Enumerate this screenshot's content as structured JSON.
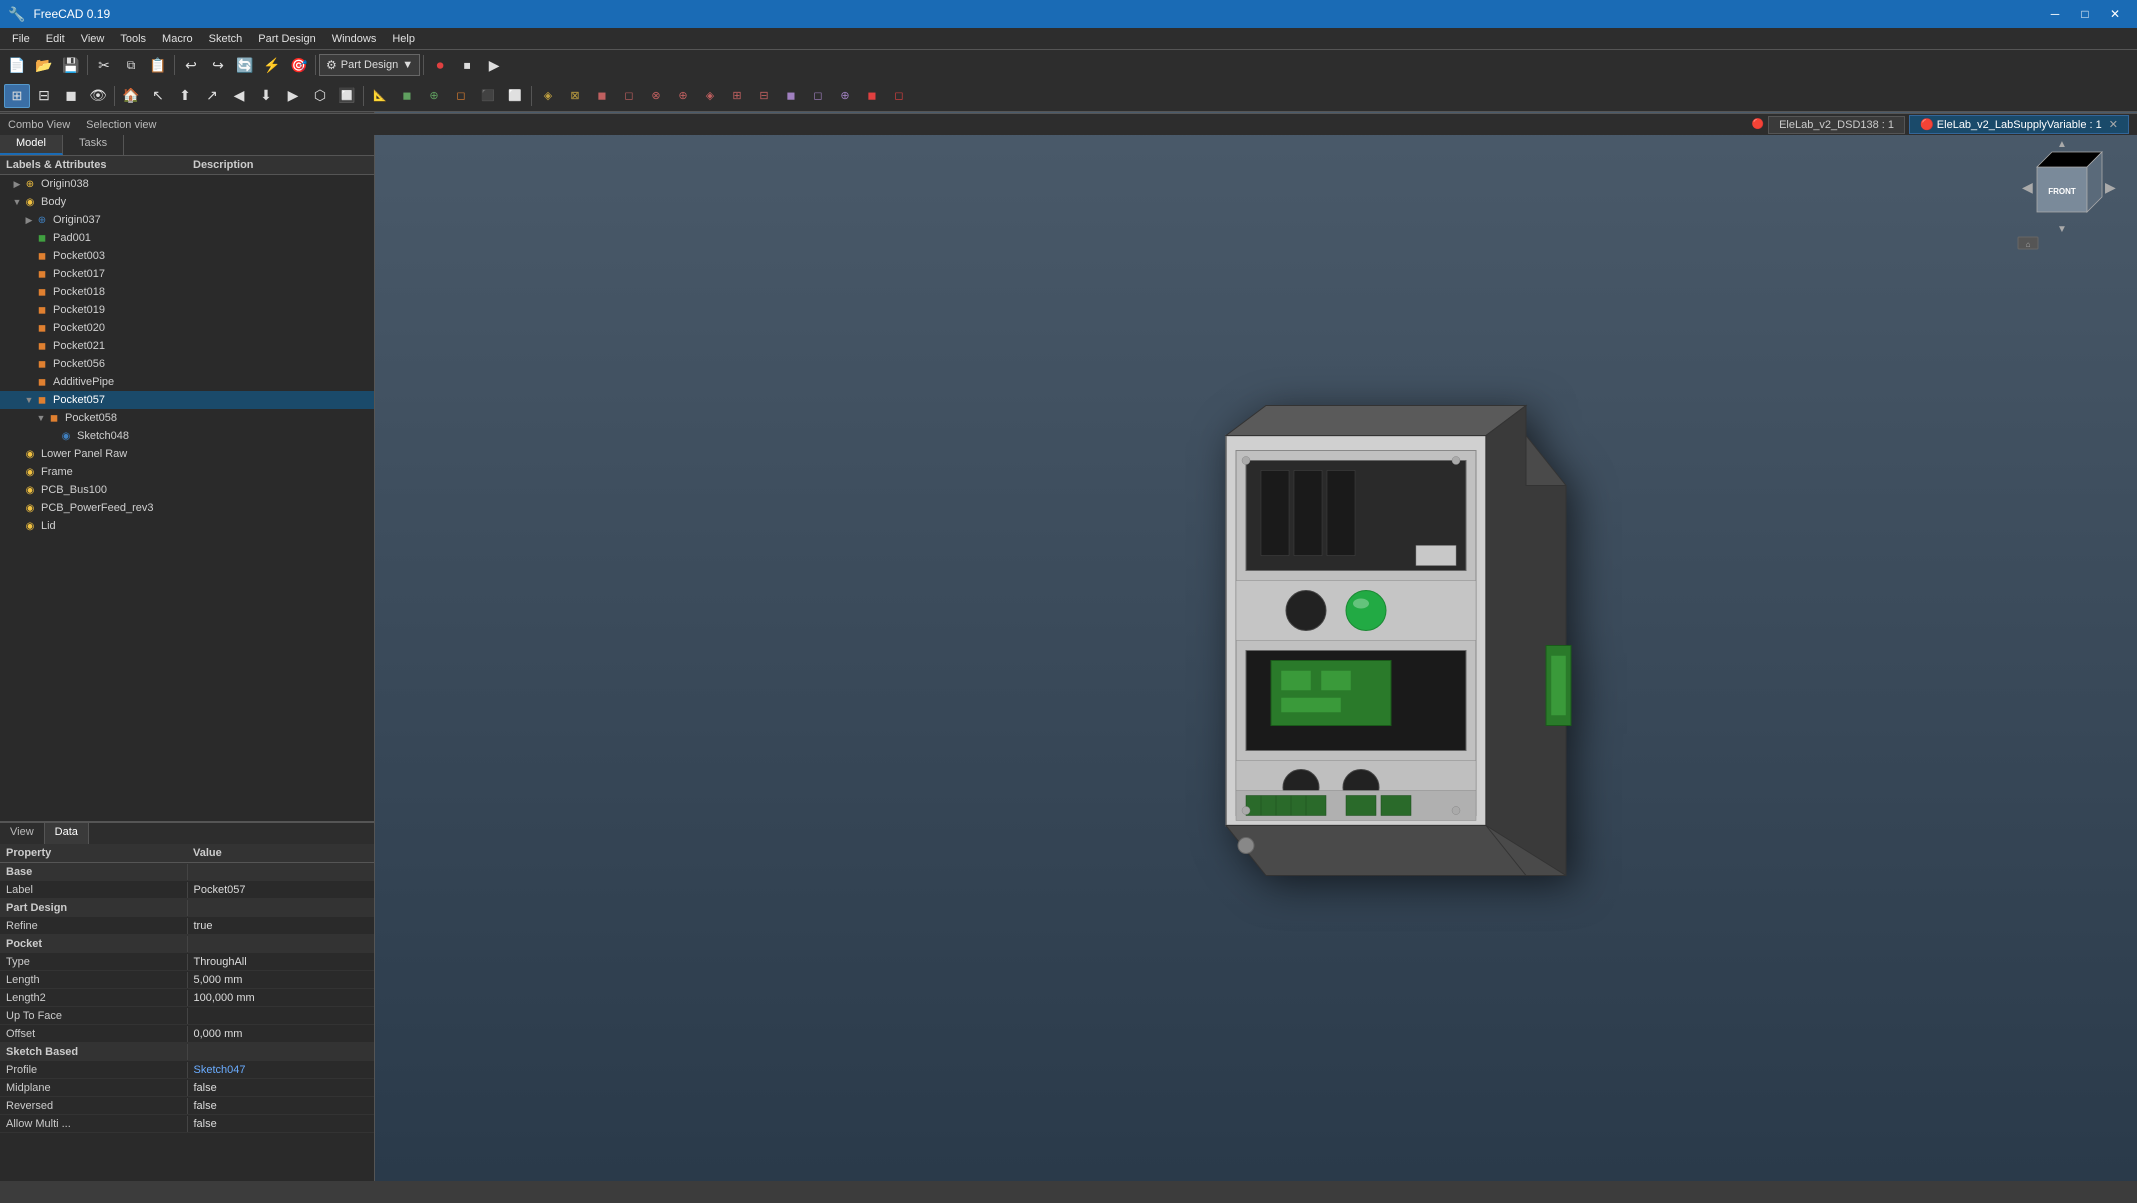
{
  "titlebar": {
    "title": "FreeCAD 0.19",
    "minimize": "─",
    "maximize": "□",
    "close": "✕"
  },
  "menubar": {
    "items": [
      "File",
      "Edit",
      "View",
      "Tools",
      "Macro",
      "Sketch",
      "Part Design",
      "Windows",
      "Help"
    ]
  },
  "toolbar": {
    "workbench_label": "Part Design",
    "toolbar1_icons": [
      "📄",
      "📂",
      "💾",
      "✂",
      "📋",
      "↩",
      "↪",
      "🔄",
      "⚡",
      "🎯"
    ],
    "toolbar2_icons": [
      "🔍",
      "🔲",
      "📐",
      "↖",
      "↗",
      "⬆",
      "◀",
      "▶",
      "⬇",
      "⚙",
      "⬡",
      "🔺",
      "📌",
      "🔗",
      "✈",
      "▷",
      "⏹",
      "📏"
    ],
    "toolbar3_icons": [
      "⬛",
      "⬜",
      "◉",
      "◈",
      "⊕",
      "⬦",
      "◇",
      "●",
      "○",
      "⊗",
      "■",
      "□",
      "▣",
      "▢",
      "⊞",
      "⊟",
      "⊠",
      "⊡",
      "▦",
      "▥",
      "▤",
      "▧",
      "▨",
      "▩",
      "◼",
      "◻"
    ]
  },
  "combo_view": {
    "header": "Combo View"
  },
  "panel_tabs": [
    {
      "label": "Model",
      "active": true
    },
    {
      "label": "Tasks",
      "active": false
    }
  ],
  "tree": {
    "col_label": "Labels & Attributes",
    "col_desc": "Description",
    "items": [
      {
        "indent": 1,
        "expand": "▶",
        "icon": "⊕",
        "icon_class": "icon-yellow",
        "label": "Origin038",
        "selected": false
      },
      {
        "indent": 1,
        "expand": "▼",
        "icon": "◉",
        "icon_class": "icon-yellow",
        "label": "Body",
        "selected": false
      },
      {
        "indent": 2,
        "expand": "▶",
        "icon": "⊕",
        "icon_class": "icon-blue",
        "label": "Origin037",
        "selected": false
      },
      {
        "indent": 2,
        "expand": "",
        "icon": "◼",
        "icon_class": "icon-green",
        "label": "Pad001",
        "selected": false
      },
      {
        "indent": 2,
        "expand": "",
        "icon": "◼",
        "icon_class": "icon-orange",
        "label": "Pocket003",
        "selected": false
      },
      {
        "indent": 2,
        "expand": "",
        "icon": "◼",
        "icon_class": "icon-orange",
        "label": "Pocket017",
        "selected": false
      },
      {
        "indent": 2,
        "expand": "",
        "icon": "◼",
        "icon_class": "icon-orange",
        "label": "Pocket018",
        "selected": false
      },
      {
        "indent": 2,
        "expand": "",
        "icon": "◼",
        "icon_class": "icon-orange",
        "label": "Pocket019",
        "selected": false
      },
      {
        "indent": 2,
        "expand": "",
        "icon": "◼",
        "icon_class": "icon-orange",
        "label": "Pocket020",
        "selected": false
      },
      {
        "indent": 2,
        "expand": "",
        "icon": "◼",
        "icon_class": "icon-orange",
        "label": "Pocket021",
        "selected": false
      },
      {
        "indent": 2,
        "expand": "",
        "icon": "◼",
        "icon_class": "icon-orange",
        "label": "Pocket056",
        "selected": false
      },
      {
        "indent": 2,
        "expand": "",
        "icon": "◼",
        "icon_class": "icon-orange",
        "label": "AdditivePipe",
        "selected": false
      },
      {
        "indent": 2,
        "expand": "▼",
        "icon": "◼",
        "icon_class": "icon-orange",
        "label": "Pocket057",
        "selected": true
      },
      {
        "indent": 3,
        "expand": "▼",
        "icon": "◼",
        "icon_class": "icon-orange",
        "label": "Pocket058",
        "selected": false
      },
      {
        "indent": 4,
        "expand": "",
        "icon": "◉",
        "icon_class": "icon-blue",
        "label": "Sketch048",
        "selected": false
      },
      {
        "indent": 1,
        "expand": "",
        "icon": "◉",
        "icon_class": "icon-yellow",
        "label": "Lower Panel Raw",
        "selected": false
      },
      {
        "indent": 1,
        "expand": "",
        "icon": "◉",
        "icon_class": "icon-yellow",
        "label": "Frame",
        "selected": false
      },
      {
        "indent": 1,
        "expand": "",
        "icon": "◉",
        "icon_class": "icon-yellow",
        "label": "PCB_Bus100",
        "selected": false
      },
      {
        "indent": 1,
        "expand": "",
        "icon": "◉",
        "icon_class": "icon-yellow",
        "label": "PCB_PowerFeed_rev3",
        "selected": false
      },
      {
        "indent": 1,
        "expand": "",
        "icon": "◉",
        "icon_class": "icon-yellow",
        "label": "Lid",
        "selected": false
      }
    ]
  },
  "properties": {
    "col_property": "Property",
    "col_value": "Value",
    "sections": [
      {
        "name": "Base",
        "rows": [
          {
            "key": "Label",
            "value": "Pocket057"
          },
          {
            "key": "Part Design",
            "value": "",
            "is_section": true
          },
          {
            "key": "Refine",
            "value": "true"
          },
          {
            "key": "Pocket",
            "value": "",
            "is_section": true
          },
          {
            "key": "Type",
            "value": "ThroughAll"
          },
          {
            "key": "Length",
            "value": "5,000 mm"
          },
          {
            "key": "Length2",
            "value": "100,000 mm"
          },
          {
            "key": "Up To Face",
            "value": ""
          },
          {
            "key": "Offset",
            "value": "0,000 mm"
          },
          {
            "key": "Sketch Based",
            "value": "",
            "is_section": true
          },
          {
            "key": "Profile",
            "value": "Sketch047"
          },
          {
            "key": "Midplane",
            "value": "false"
          },
          {
            "key": "Reversed",
            "value": "false"
          },
          {
            "key": "Allow Multi ...",
            "value": "false"
          }
        ]
      }
    ]
  },
  "bottom_tabs": [
    {
      "label": "View",
      "active": false
    },
    {
      "label": "Data",
      "active": true
    }
  ],
  "statusbar": {
    "combo_view": "Combo View",
    "selection_view": "Selection view",
    "file1": "EleLab_v2_DSD138 : 1",
    "file2": "EleLab_v2_LabSupplyVariable : 1"
  },
  "nav_cube": {
    "front": "FRONT"
  },
  "colors": {
    "titlebar_bg": "#1a6bb5",
    "selected_row": "#1a4a6a",
    "section_header": "#e0c060",
    "active_tab": "#3a6ea5"
  }
}
